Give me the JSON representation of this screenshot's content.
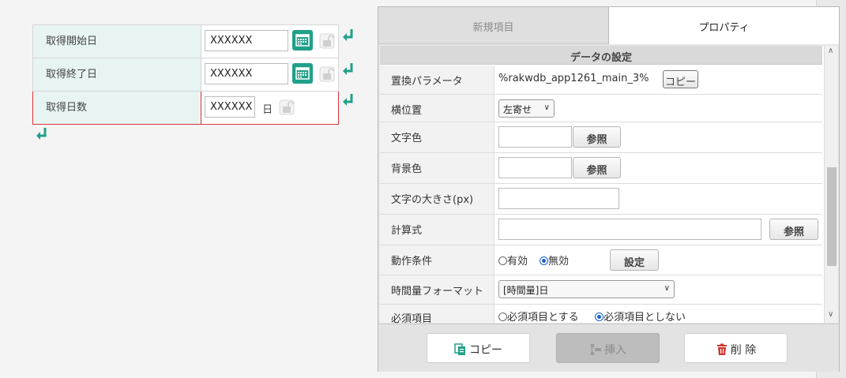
{
  "form": {
    "rows": [
      {
        "label": "取得開始日",
        "value": "XXXXXX"
      },
      {
        "label": "取得終了日",
        "value": "XXXXXX"
      },
      {
        "label": "取得日数",
        "value": "XXXXXX",
        "unit": "日"
      }
    ]
  },
  "panel": {
    "tabs": [
      {
        "label": "新規項目",
        "active": false
      },
      {
        "label": "プロパティ",
        "active": true
      }
    ],
    "section_title": "データの設定",
    "properties": {
      "replace_param": {
        "label": "置換パラメータ",
        "value": "%rakwdb_app1261_main_3%",
        "button": "コピー"
      },
      "h_position": {
        "label": "横位置",
        "selected": "左寄せ"
      },
      "text_color": {
        "label": "文字色",
        "value": "",
        "button": "参照"
      },
      "bg_color": {
        "label": "背景色",
        "value": "",
        "button": "参照"
      },
      "font_size": {
        "label": "文字の大きさ(px)",
        "value": ""
      },
      "formula": {
        "label": "計算式",
        "value": "",
        "button": "参照"
      },
      "condition": {
        "label": "動作条件",
        "option_enabled": "有効",
        "option_disabled": "無効",
        "selected": "無効",
        "button": "設定"
      },
      "time_format": {
        "label": "時間量フォーマット",
        "selected": "[時間量]日"
      },
      "required": {
        "label": "必須項目",
        "option_required": "必須項目とする",
        "option_not_required": "必須項目としない",
        "selected": "必須項目としない"
      }
    },
    "footer": {
      "copy_label": "コピー",
      "insert_label": "挿入",
      "delete_label": "削 除"
    }
  },
  "colors": {
    "accent": "#20a089",
    "selected_border": "#d9343a",
    "label_bg": "#e8f4f2",
    "radio_on": "#1a5fd0",
    "delete_icon": "#d0342c"
  }
}
